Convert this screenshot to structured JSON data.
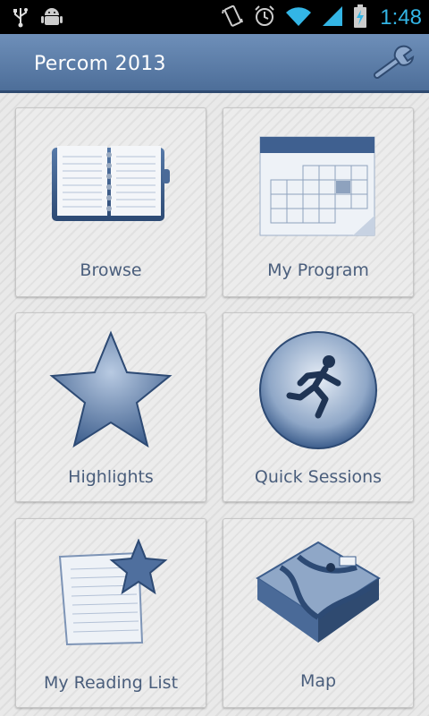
{
  "status_bar": {
    "time": "1:48",
    "icons": [
      "usb-icon",
      "android-debug-icon",
      "vibrate-icon",
      "alarm-icon",
      "wifi-icon",
      "signal-icon",
      "battery-charging-icon"
    ]
  },
  "action_bar": {
    "title": "Percom 2013",
    "settings_icon": "wrench-icon"
  },
  "tiles": [
    {
      "label": "Browse",
      "icon": "datebook-icon"
    },
    {
      "label": "My Program",
      "icon": "calendar-icon"
    },
    {
      "label": "Highlights",
      "icon": "star-icon"
    },
    {
      "label": "Quick Sessions",
      "icon": "runner-icon"
    },
    {
      "label": "My Reading List",
      "icon": "notepad-star-icon"
    },
    {
      "label": "Map",
      "icon": "map-terrain-icon"
    }
  ],
  "colors": {
    "accent": "#33b5e5",
    "actionbar": "#5a7aa6",
    "label": "#4a5e7c"
  }
}
